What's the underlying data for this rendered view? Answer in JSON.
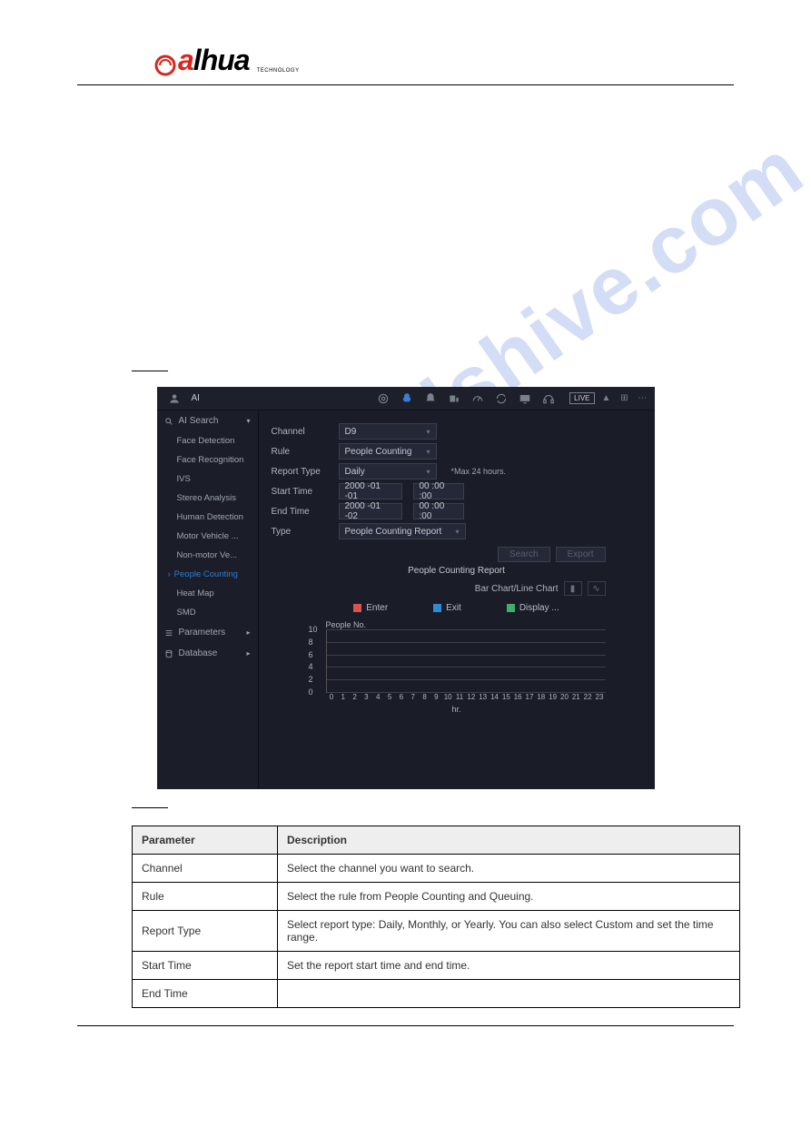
{
  "logo": {
    "text_pre": "a",
    "text_mid": "lhua",
    "sub": "TECHNOLOGY"
  },
  "screenshot": {
    "top": {
      "ai_label": "AI",
      "live": "LIVE"
    },
    "sidebar": {
      "sections": [
        {
          "label": "AI Search",
          "expanded": true
        },
        {
          "label": "Parameters",
          "expanded": false
        },
        {
          "label": "Database",
          "expanded": false
        }
      ],
      "items": [
        "Face Detection",
        "Face Recognition",
        "IVS",
        "Stereo Analysis",
        "Human Detection",
        "Motor Vehicle ...",
        "Non-motor Ve...",
        "People Counting",
        "Heat Map",
        "SMD"
      ],
      "active_index": 7
    },
    "form": {
      "channel_label": "Channel",
      "channel_value": "D9",
      "rule_label": "Rule",
      "rule_value": "People Counting",
      "report_type_label": "Report Type",
      "report_type_value": "Daily",
      "report_note": "*Max 24 hours.",
      "start_label": "Start Time",
      "start_date": "2000 -01 -01",
      "start_time": "00 :00 :00",
      "end_label": "End Time",
      "end_date": "2000 -01 -02",
      "end_time": "00 :00 :00",
      "type_label": "Type",
      "type_value": "People Counting Report"
    },
    "buttons": {
      "search": "Search",
      "export": "Export"
    },
    "chart": {
      "title": "People Counting Report",
      "toggle_label": "Bar Chart/Line Chart",
      "legend": {
        "enter": "Enter",
        "exit": "Exit",
        "display": "Display ..."
      },
      "ylabel": "People No.",
      "xlabel": "hr."
    }
  },
  "chart_data": {
    "type": "bar",
    "title": "People Counting Report",
    "ylabel": "People No.",
    "xlabel": "hr.",
    "yticks": [
      0,
      2,
      4,
      6,
      8,
      10
    ],
    "ylim": [
      0,
      10
    ],
    "categories": [
      0,
      1,
      2,
      3,
      4,
      5,
      6,
      7,
      8,
      9,
      10,
      11,
      12,
      13,
      14,
      15,
      16,
      17,
      18,
      19,
      20,
      21,
      22,
      23
    ],
    "series": [
      {
        "name": "Enter",
        "color": "#d9534f",
        "values": [
          0,
          0,
          0,
          0,
          0,
          0,
          0,
          0,
          0,
          0,
          0,
          0,
          0,
          0,
          0,
          0,
          0,
          0,
          0,
          0,
          0,
          0,
          0,
          0
        ]
      },
      {
        "name": "Exit",
        "color": "#2d8cd6",
        "values": [
          0,
          0,
          0,
          0,
          0,
          0,
          0,
          0,
          0,
          0,
          0,
          0,
          0,
          0,
          0,
          0,
          0,
          0,
          0,
          0,
          0,
          0,
          0,
          0
        ]
      },
      {
        "name": "Display",
        "color": "#3fae6a",
        "values": [
          0,
          0,
          0,
          0,
          0,
          0,
          0,
          0,
          0,
          0,
          0,
          0,
          0,
          0,
          0,
          0,
          0,
          0,
          0,
          0,
          0,
          0,
          0,
          0
        ]
      }
    ]
  },
  "params_table": {
    "header_param": "Parameter",
    "header_desc": "Description",
    "rows": [
      {
        "param": "Channel",
        "desc": "Select the channel you want to search."
      },
      {
        "param": "Rule",
        "desc": "Select the rule from People Counting and Queuing."
      },
      {
        "param": "Report Type",
        "desc": "Select report type: Daily, Monthly, or Yearly. You can also select Custom and set the time range."
      },
      {
        "param": "Start Time",
        "desc": "Set the report start time and end time."
      },
      {
        "param": "End Time",
        "desc": ""
      }
    ]
  }
}
